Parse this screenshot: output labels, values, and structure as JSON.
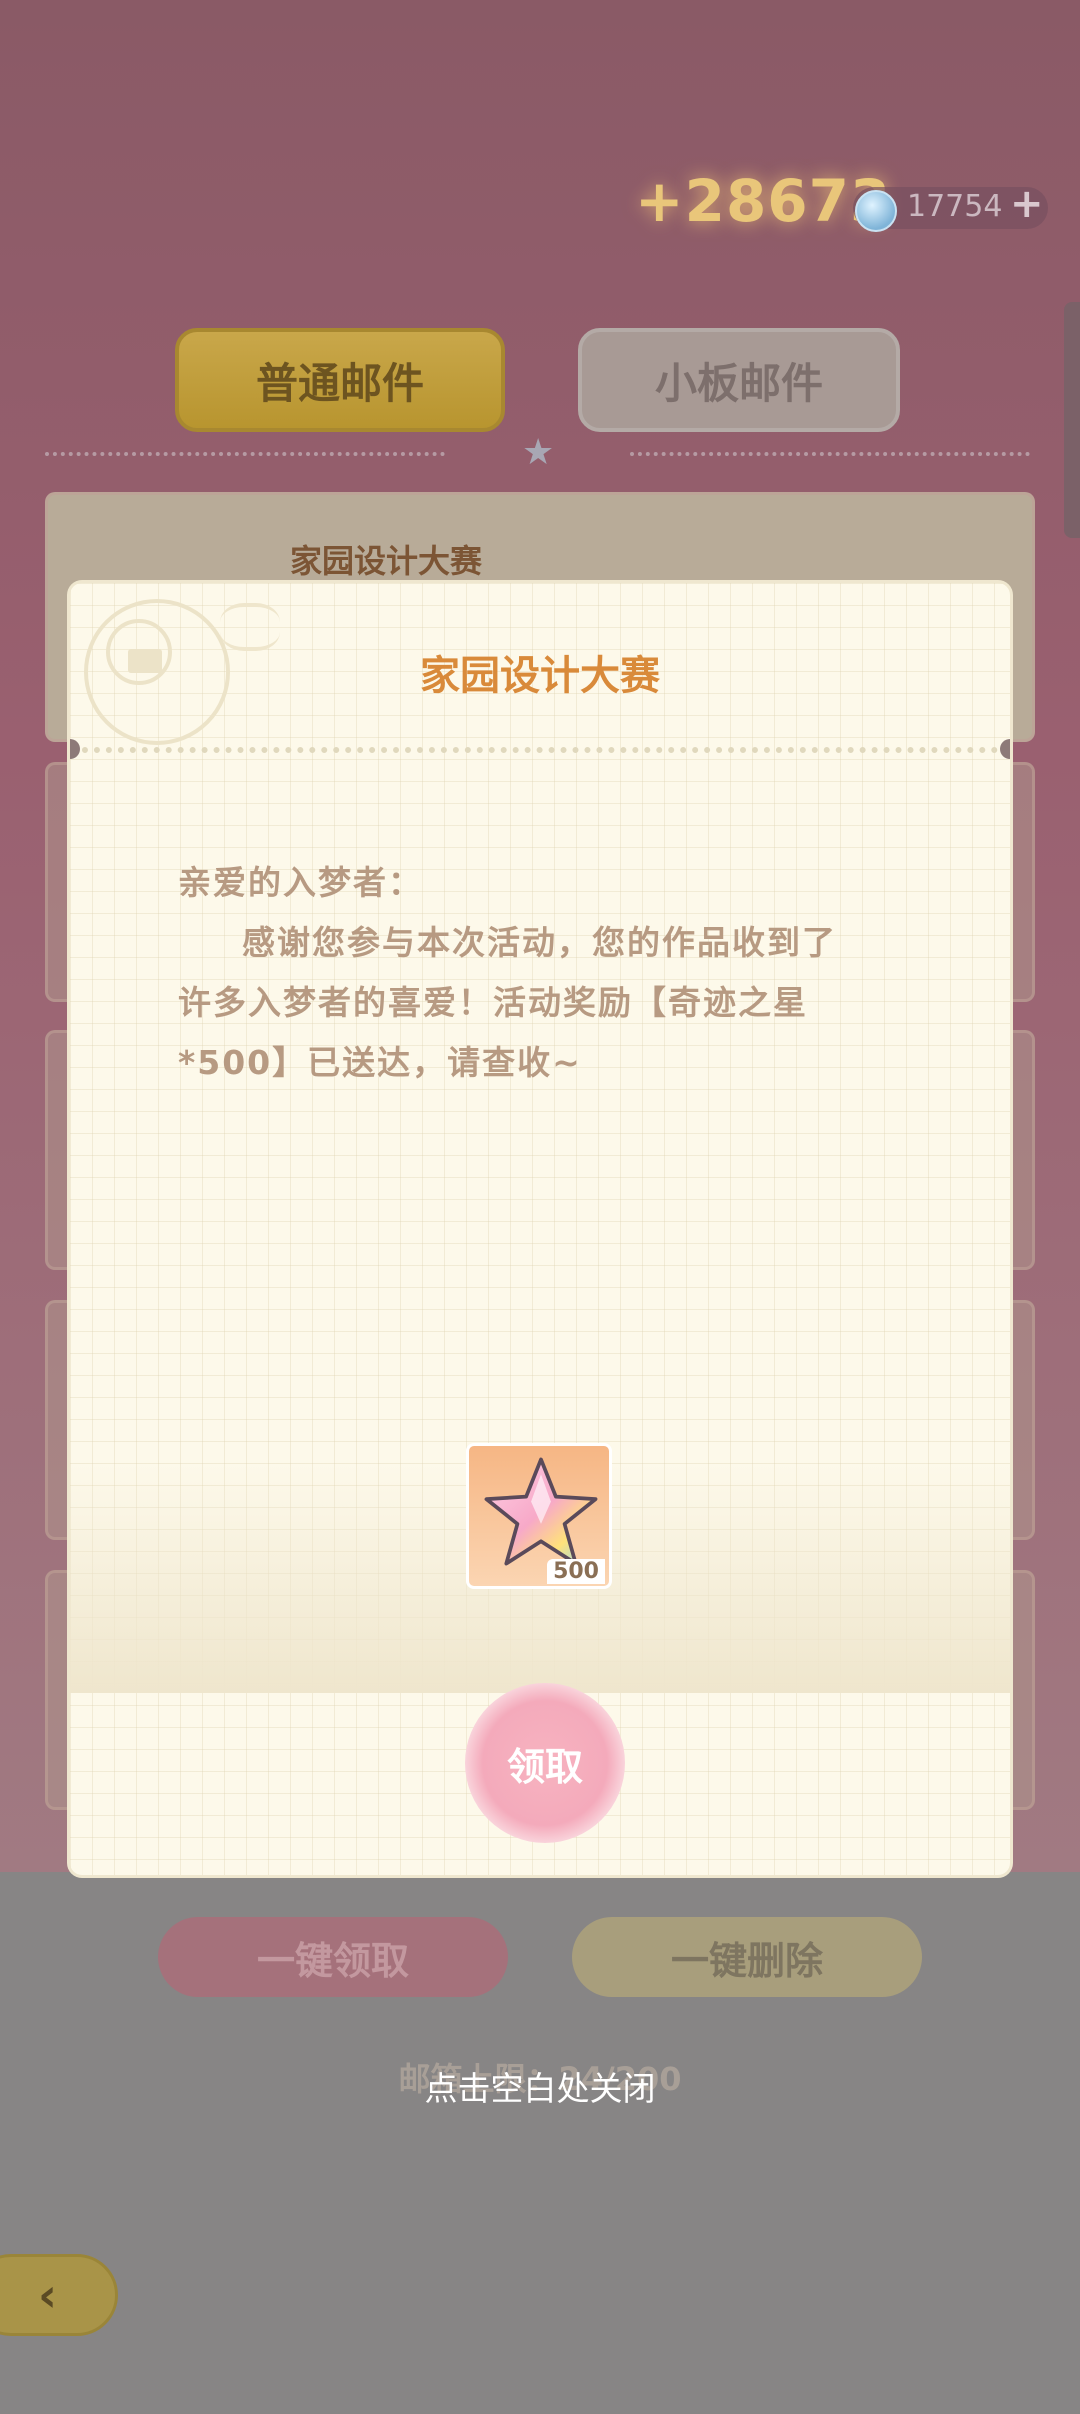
{
  "header": {
    "gold_amount": "+28673",
    "gem_amount": "17754",
    "gem_plus": "+"
  },
  "tabs": [
    {
      "label": "普通邮件",
      "active": true
    },
    {
      "label": "小板邮件",
      "active": false
    }
  ],
  "mail_list": {
    "first_item_title": "家园设计大赛"
  },
  "footer": {
    "claim_all_label": "一键领取",
    "delete_all_label": "一键删除",
    "capacity_text": "邮箱上限：24/200"
  },
  "modal": {
    "title": "家园设计大赛",
    "greeting": "亲爱的入梦者：",
    "body_line1": "感谢您参与本次活动，您的作品收到了",
    "body_line2": "许多入梦者的喜爱！活动奖励【奇迹之星",
    "body_line3": "*500】已送达，请查收~",
    "reward": {
      "icon": "miracle-star-icon",
      "count": "500"
    },
    "claim_label": "领取"
  },
  "close_hint": "点击空白处关闭",
  "colors": {
    "title_orange": "#d98a3a",
    "claim_pink": "#f4aabb",
    "paper": "#fdf9ea"
  }
}
